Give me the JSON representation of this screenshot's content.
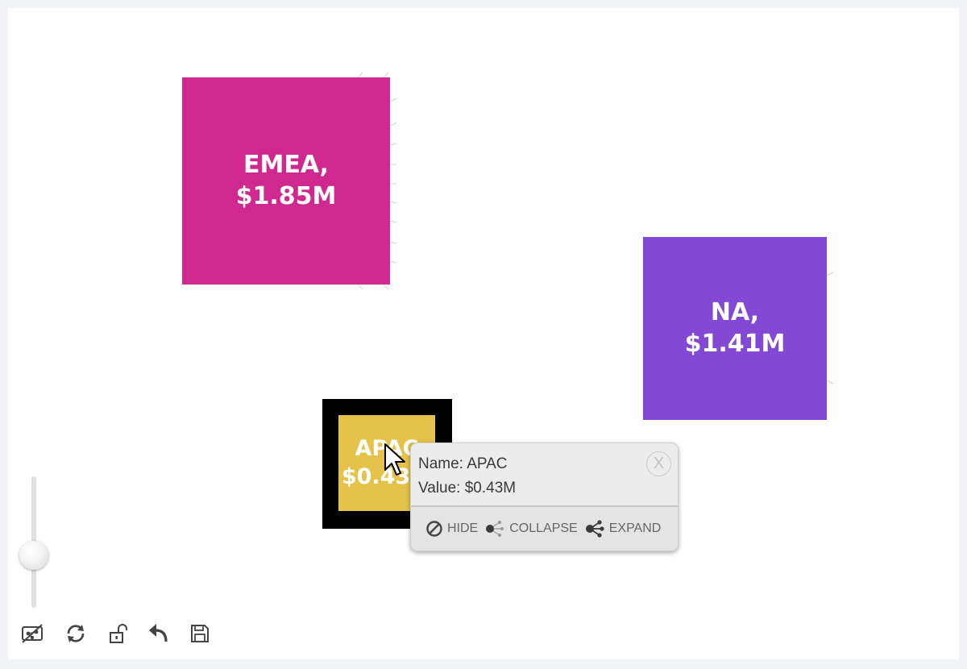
{
  "nodes": {
    "emea": {
      "label": "EMEA,\n$1.85M",
      "color": "#cf2990"
    },
    "na": {
      "label": "NA,\n$1.41M",
      "color": "#8348d4"
    },
    "apac": {
      "label": "APAC\n$0.43M",
      "color": "#e5c34a",
      "selected": true
    }
  },
  "tooltip": {
    "name_line": "Name: APAC",
    "value_line": "Value: $0.43M",
    "close_label": "X",
    "actions": {
      "hide": "HIDE",
      "collapse": "COLLAPSE",
      "expand": "EXPAND"
    }
  },
  "zoom": {
    "level": 0.4
  },
  "toolbar": [
    {
      "icon": "fit-view-icon"
    },
    {
      "icon": "refresh-icon"
    },
    {
      "icon": "unlock-icon"
    },
    {
      "icon": "undo-icon"
    },
    {
      "icon": "save-icon"
    }
  ]
}
